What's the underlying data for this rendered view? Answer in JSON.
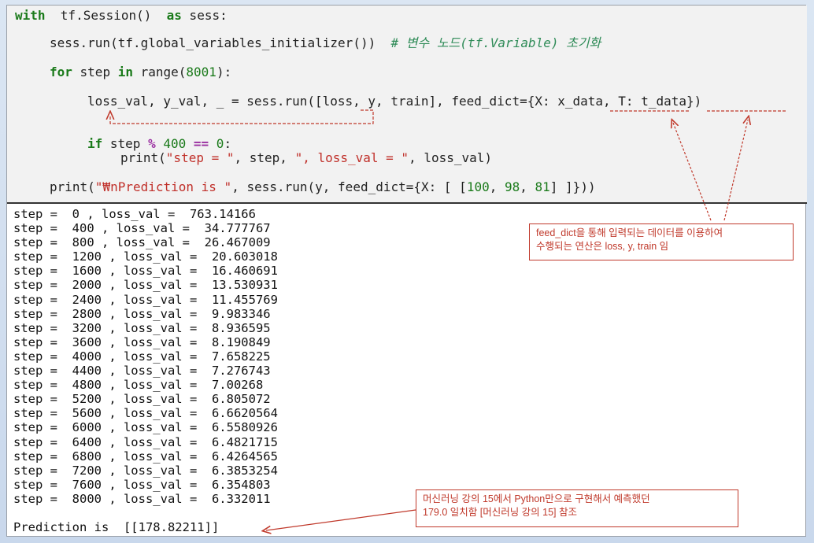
{
  "code": {
    "line1": {
      "kw1": "with",
      "text": "  tf.Session()  ",
      "kw2": "as",
      "text2": " sess:"
    },
    "line2": {
      "text": "sess.run(tf.global_variables_initializer())",
      "comment": "  # 변수 노드(tf.Variable) 초기화"
    },
    "line3": {
      "kw": "for",
      "text1": " step ",
      "kw2": "in",
      "text2": " range(",
      "num": "8001",
      "text3": "):"
    },
    "line4": "loss_val, y_val, _ = sess.run([loss, y, train], feed_dict={X: x_data, T: t_data})",
    "line5": {
      "kw": "if",
      "text1": " step ",
      "op": "%",
      "text2": " ",
      "num1": "400",
      "text3": " ",
      "op2": "==",
      "text4": " ",
      "num2": "0",
      ":": ":"
    },
    "line6": {
      "fn": "print(",
      "s1": "\"step = \"",
      "t1": ", step, ",
      "s2": "\", loss_val = \"",
      "t2": ", loss_val)"
    },
    "line7": {
      "fn": "print(",
      "s1": "\"₩nPrediction is \"",
      "t1": ", sess.run(y, feed_dict={X: [ [",
      "n1": "100",
      "t2": ", ",
      "n2": "98",
      "t3": ", ",
      "n3": "81",
      "t4": "] ]}))"
    }
  },
  "output": {
    "rows": [
      "step =  0 , loss_val =  763.14166",
      "step =  400 , loss_val =  34.777767",
      "step =  800 , loss_val =  26.467009",
      "step =  1200 , loss_val =  20.603018",
      "step =  1600 , loss_val =  16.460691",
      "step =  2000 , loss_val =  13.530931",
      "step =  2400 , loss_val =  11.455769",
      "step =  2800 , loss_val =  9.983346",
      "step =  3200 , loss_val =  8.936595",
      "step =  3600 , loss_val =  8.190849",
      "step =  4000 , loss_val =  7.658225",
      "step =  4400 , loss_val =  7.276743",
      "step =  4800 , loss_val =  7.00268",
      "step =  5200 , loss_val =  6.805072",
      "step =  5600 , loss_val =  6.6620564",
      "step =  6000 , loss_val =  6.5580926",
      "step =  6400 , loss_val =  6.4821715",
      "step =  6800 , loss_val =  6.4264565",
      "step =  7200 , loss_val =  6.3853254",
      "step =  7600 , loss_val =  6.354803",
      "step =  8000 , loss_val =  6.332011"
    ],
    "prediction": "Prediction is  [[178.82211]]"
  },
  "callouts": {
    "feed": {
      "line1": "feed_dict을  통해 입력되는 데이터를 이용하여",
      "line2": "수행되는 연산은  loss,  y,  train  임"
    },
    "pred": {
      "line1": "머신러닝 강의 15에서 Python만으로 구현해서 예측했던",
      "line2": "179.0 일치함 [머신러닝 강의 15] 참조"
    }
  },
  "colors": {
    "annotation": "#c0392b",
    "keyword": "#1a7a1a",
    "string": "#c0302a",
    "operator": "#9a2fa0"
  }
}
